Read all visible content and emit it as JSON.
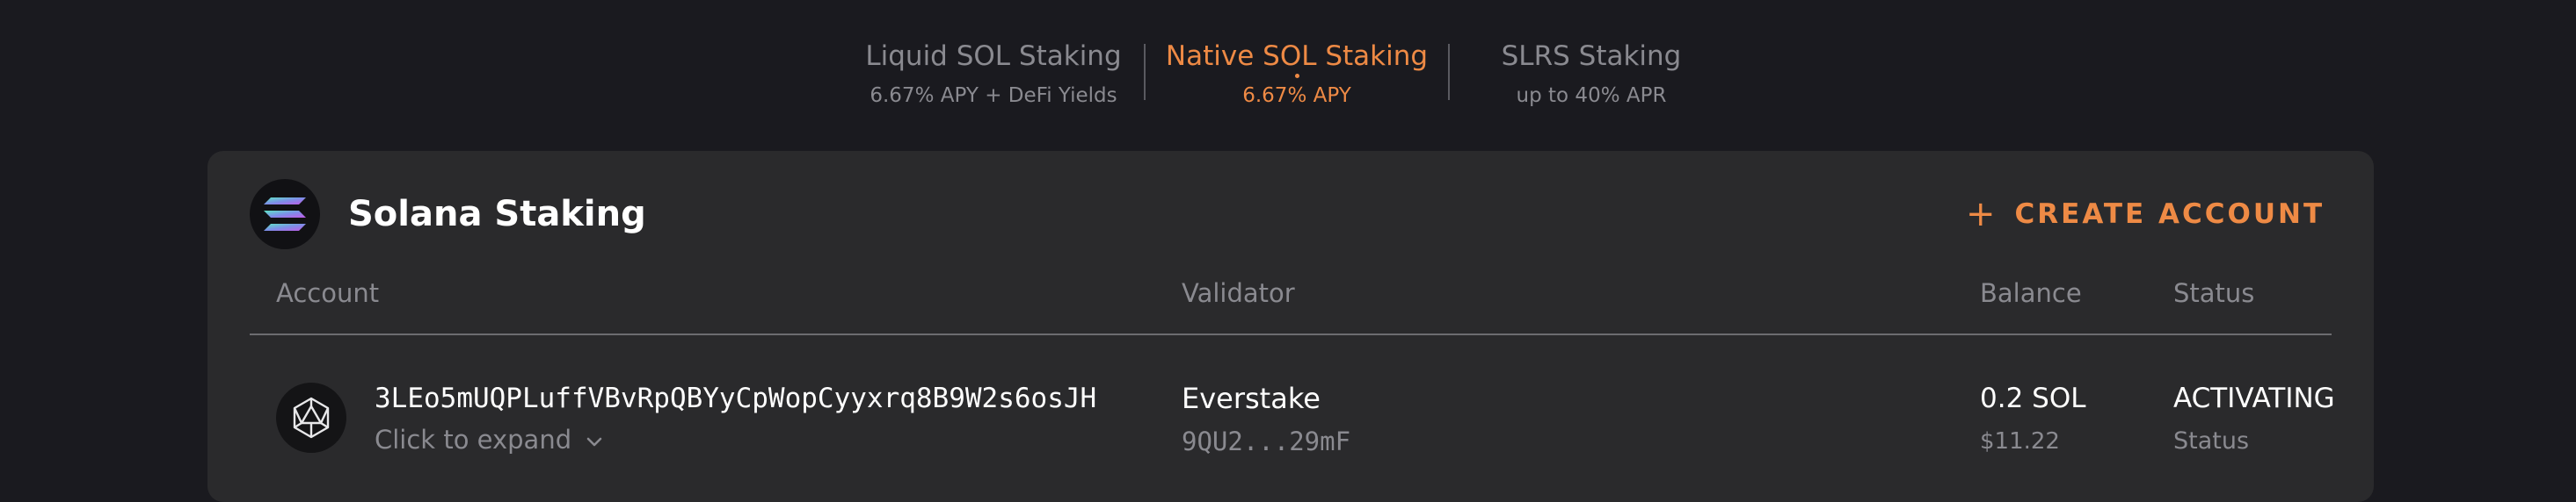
{
  "tabs": [
    {
      "label": "Liquid SOL Staking",
      "sub": "6.67% APY + DeFi Yields",
      "active": false
    },
    {
      "label": "Native SOL Staking",
      "sub": "6.67% APY",
      "active": true
    },
    {
      "label": "SLRS Staking",
      "sub": "up to 40% APR",
      "active": false
    }
  ],
  "colors": {
    "accent": "#ee8a45",
    "background": "#1a1a1f",
    "card": "#2a2a2c",
    "muted_text": "#8a8a90"
  },
  "card": {
    "logo_icon": "solana-logo-icon",
    "title": "Solana Staking",
    "create_button": {
      "icon": "plus-icon",
      "label": "CREATE ACCOUNT"
    }
  },
  "table": {
    "headers": {
      "account": "Account",
      "validator": "Validator",
      "balance": "Balance",
      "status": "Status"
    },
    "rows": [
      {
        "account_icon": "stake-account-icon",
        "account_address": "3LEo5mUQPLuffVBvRpQBYyCpWopCyyxrq8B9W2s6osJH",
        "expand_label": "Click to expand",
        "expand_icon": "chevron-down-icon",
        "validator_name": "Everstake",
        "validator_address": "9QU2...29mF",
        "balance_sol": "0.2 SOL",
        "balance_usd": "$11.22",
        "status": "ACTIVATING",
        "status_label": "Status"
      }
    ]
  }
}
